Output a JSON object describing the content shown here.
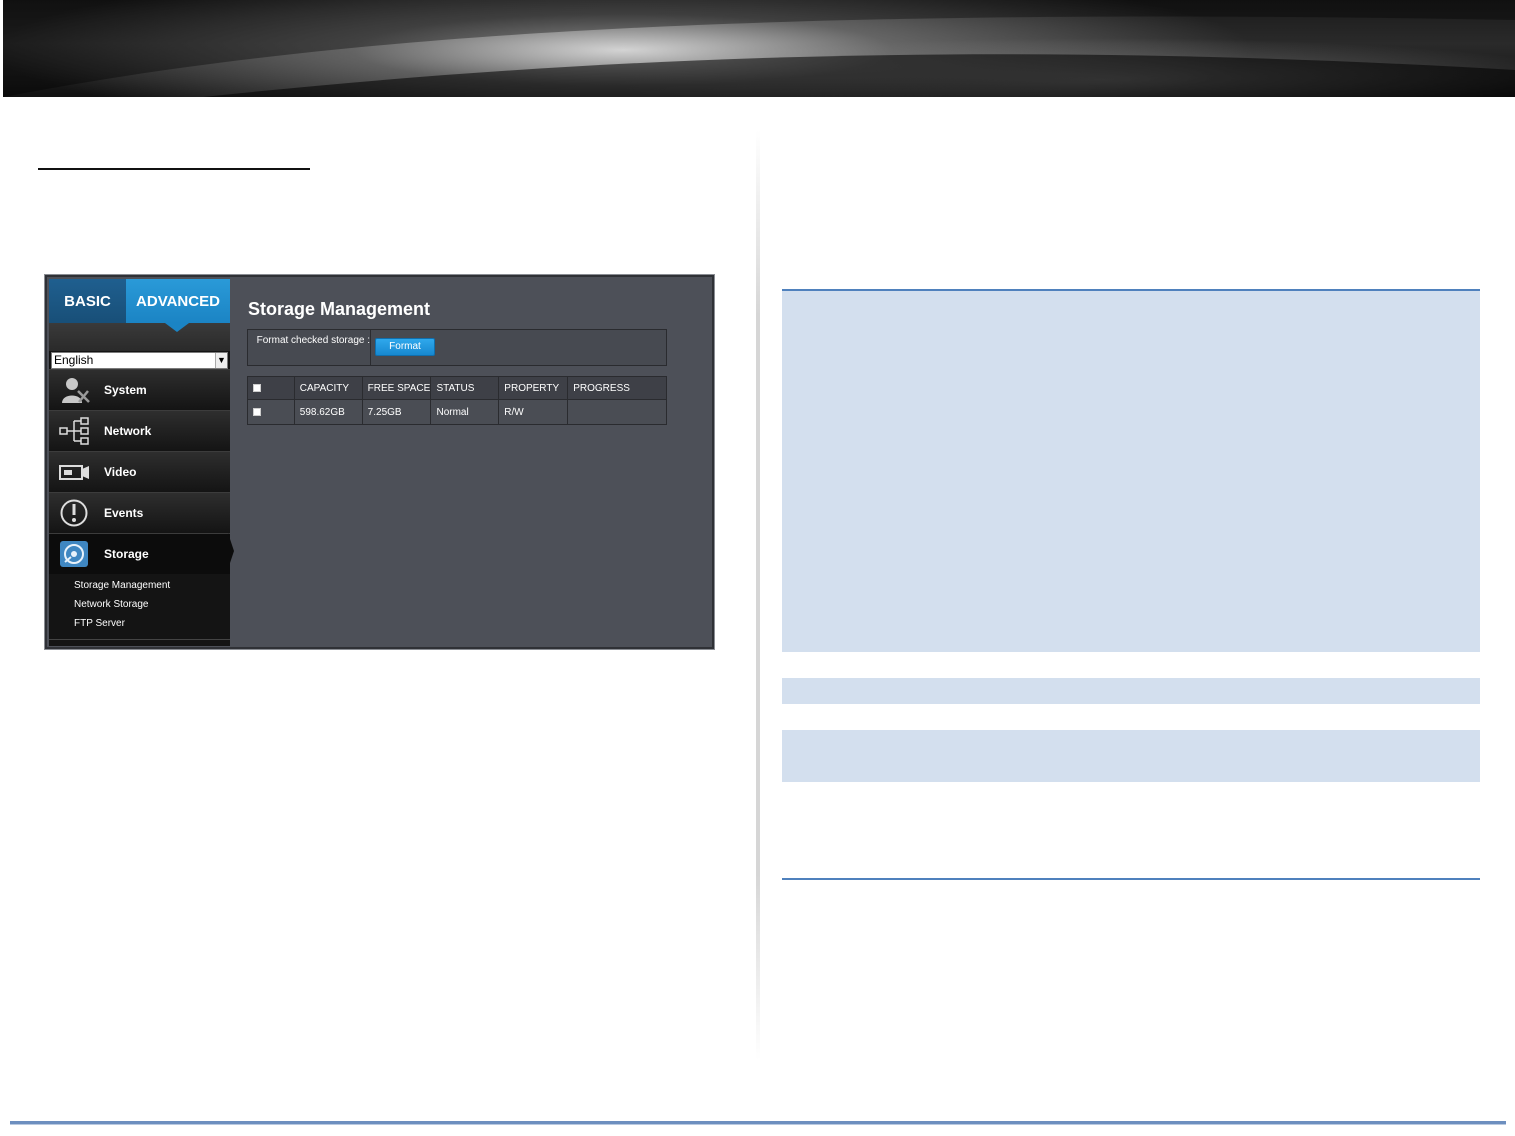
{
  "camera_ui": {
    "tabs": {
      "basic": "BASIC",
      "advanced": "ADVANCED"
    },
    "language": {
      "selected": "English"
    },
    "nav": [
      {
        "label": "System",
        "icon": "system-tools-icon"
      },
      {
        "label": "Network",
        "icon": "network-tree-icon"
      },
      {
        "label": "Video",
        "icon": "video-camera-icon"
      },
      {
        "label": "Events",
        "icon": "alert-icon"
      },
      {
        "label": "Storage",
        "icon": "disk-icon"
      }
    ],
    "storage_submenu": [
      "Storage Management",
      "Network Storage",
      "FTP Server"
    ],
    "page_title": "Storage Management",
    "format": {
      "label": "Format checked storage :",
      "button": "Format"
    },
    "table": {
      "headers": [
        "CAPACITY",
        "FREE SPACE",
        "STATUS",
        "PROPERTY",
        "PROGRESS"
      ],
      "rows": [
        {
          "capacity": "598.62GB",
          "free_space": "7.25GB",
          "status": "Normal",
          "property": "R/W",
          "progress": ""
        }
      ]
    }
  },
  "colors": {
    "accent_blue": "#1b84c4",
    "panel_bg": "#4d5058",
    "shade_box": "#d3dfee",
    "rule_blue": "#4f81bd"
  }
}
